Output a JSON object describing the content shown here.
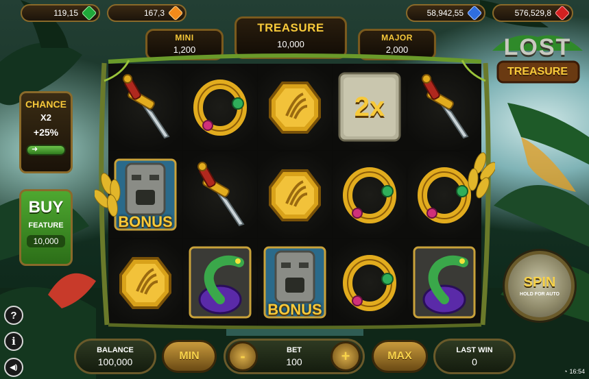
{
  "top_jackpots": [
    {
      "value": "119,15",
      "gem": "green-gem",
      "color": "#1fa83a"
    },
    {
      "value": "167,3",
      "gem": "orange-gem",
      "color": "#f28a1a"
    },
    {
      "value": "58,942,55",
      "gem": "blue-gem",
      "color": "#2f6ee0"
    },
    {
      "value": "576,529,8",
      "gem": "red-gem",
      "color": "#d42020"
    }
  ],
  "jackpots": {
    "mini": {
      "label": "MINI",
      "value": "1,200"
    },
    "treasure": {
      "label": "TREASURE",
      "value": "10,000"
    },
    "major": {
      "label": "MAJOR",
      "value": "2,000"
    }
  },
  "logo": {
    "line1": "LOST",
    "line2": "TREASURE"
  },
  "chance": {
    "title": "CHANCE",
    "mult": "X2",
    "pct": "+25%",
    "toggle": "➜"
  },
  "buy": {
    "title": "BUY",
    "subtitle": "FEATURE",
    "price": "10,000"
  },
  "reels": [
    [
      "dagger",
      "bonus-idol",
      "coin"
    ],
    [
      "ring",
      "dagger",
      "snake"
    ],
    [
      "coin",
      "coin",
      "bonus-idol"
    ],
    [
      "multiplier",
      "ring",
      "ring"
    ],
    [
      "dagger",
      "ring",
      "snake"
    ]
  ],
  "symbols": {
    "multiplier_text": "2x",
    "bonus_text": "BONUS"
  },
  "balance": {
    "label": "BALANCE",
    "value": "100,000"
  },
  "bet": {
    "label": "BET",
    "value": "100",
    "min_label": "MIN",
    "max_label": "MAX",
    "minus": "-",
    "plus": "+"
  },
  "last_win": {
    "label": "LAST WIN",
    "value": "0"
  },
  "spin": {
    "label": "SPIN",
    "sub": "HOLD FOR AUTO"
  },
  "side_icons": {
    "help": "?",
    "info": "i",
    "sound": "◀)"
  },
  "clock": "16:54",
  "accent_color": "#f7c93a"
}
